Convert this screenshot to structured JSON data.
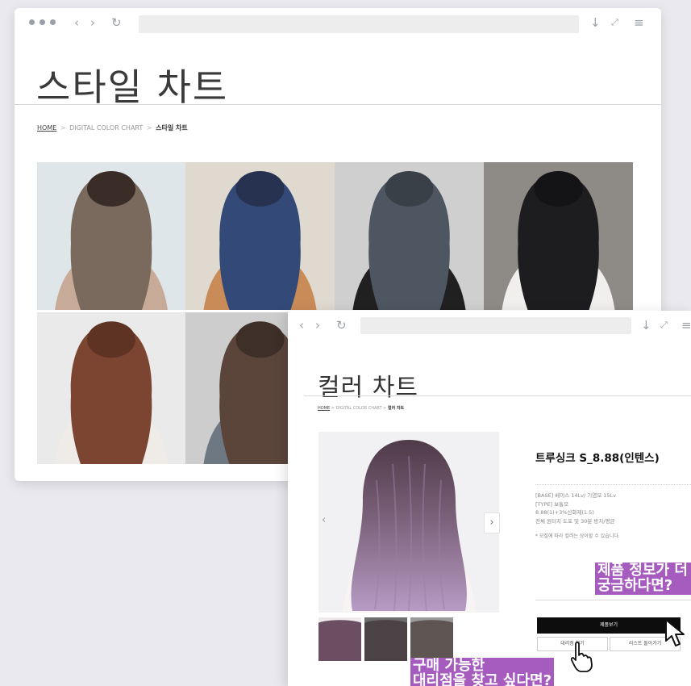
{
  "back_window": {
    "page_title": "스타일 차트",
    "breadcrumb": {
      "home": "HOME",
      "middle": "DIGITAL COLOR CHART",
      "current": "스타일 차트",
      "separator": ">"
    },
    "gallery": [
      {
        "bg": "#dfe6ea",
        "hair": "#7a6a5e",
        "top": "#3a2c26",
        "shirt": "#c7ab98"
      },
      {
        "bg": "#dfd9cf",
        "hair": "#334a78",
        "top": "#26324f",
        "shirt": "#c98b58"
      },
      {
        "bg": "#cfcfcf",
        "hair": "#4d5661",
        "top": "#3a4048",
        "shirt": "#202020"
      },
      {
        "bg": "#8e8a86",
        "hair": "#1d1d1f",
        "top": "#141416",
        "shirt": "#f1efed"
      },
      {
        "bg": "#eaeaea",
        "hair": "#7c4532",
        "top": "#5e3323",
        "shirt": "#efece8"
      },
      {
        "bg": "#cdcdcd",
        "hair": "#5b453b",
        "top": "#3e2f28",
        "shirt": "#6e7882"
      }
    ]
  },
  "front_window": {
    "page_title": "컬러 차트",
    "breadcrumb": {
      "home": "HOME",
      "middle": "DIGITAL COLOR CHART",
      "current": "컬러 차트",
      "separator": ">"
    },
    "product": {
      "name": "트루싱크 S_8.88(인텐스)",
      "info_lines": [
        "[BASE] 베이스 14Lv/ 기염모 15Lv",
        "[TYPE] 보통모",
        "8.88(1)+3%산화제(1.5)",
        "전체 원터치 도포 및 30분 방치/평균"
      ],
      "note": "* 모질에 따라 컬러는 상이할 수 있습니다.",
      "view_button": "제품보기",
      "dealer_button": "대리점 찾기",
      "list_button": "리스트 돌아가기"
    },
    "thumbnails": [
      {
        "bg": "#eeeaee",
        "hair": "#6b4e62"
      },
      {
        "bg": "#6d6d6d",
        "hair": "#4a4244"
      },
      {
        "bg": "#9a9a9a",
        "hair": "#5e5452"
      }
    ]
  },
  "callouts": {
    "product_info_line1": "제품 정보가 더",
    "product_info_line2": "궁금하다면?",
    "dealer_line1": "구매 가능한",
    "dealer_line2": "대리점을 찾고 싶다면?"
  },
  "colors": {
    "accent_purple": "#a65cbf",
    "button_black": "#0d0d0d"
  }
}
